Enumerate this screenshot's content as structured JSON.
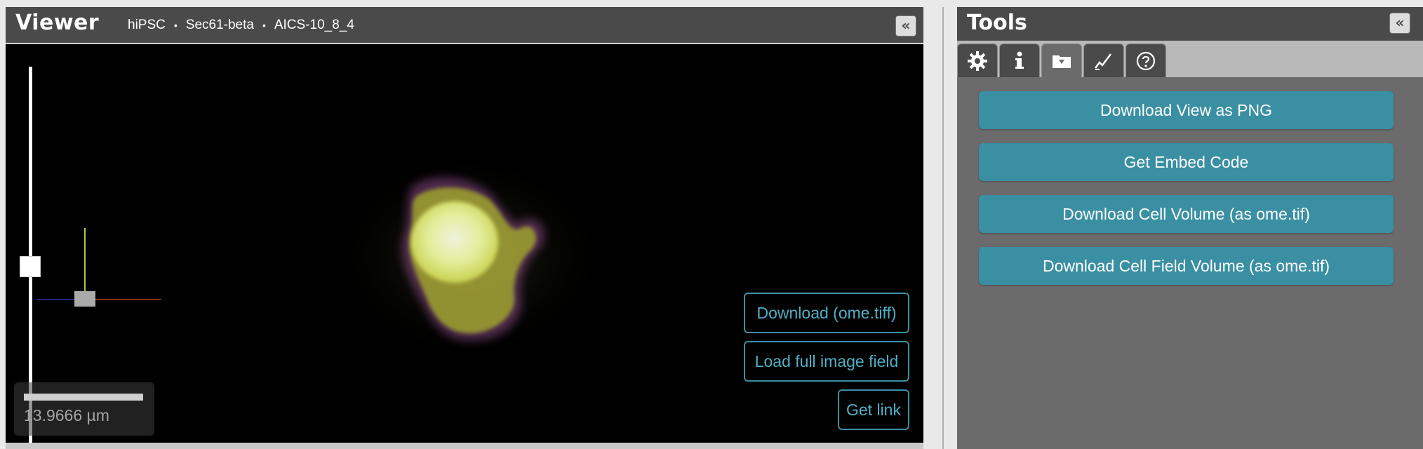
{
  "viewer": {
    "title": "Viewer",
    "breadcrumb": [
      "hiPSC",
      "Sec61-beta",
      "AICS-10_8_4"
    ],
    "breadcrumb_separator": "•",
    "collapse_glyph": "«",
    "scale_label": "13.9666 µm",
    "overlay_buttons": {
      "download_ome": "Download (ome.tiff)",
      "load_full": "Load full image field",
      "get_link": "Get link"
    }
  },
  "tools": {
    "title": "Tools",
    "collapse_glyph": "«",
    "tabs": [
      {
        "icon": "gear-icon",
        "active": false
      },
      {
        "icon": "info-icon",
        "active": false
      },
      {
        "icon": "download-folder-icon",
        "active": true
      },
      {
        "icon": "chart-line-icon",
        "active": false
      },
      {
        "icon": "help-icon",
        "active": false
      }
    ],
    "buttons": [
      "Download View as PNG",
      "Get Embed Code",
      "Download Cell Volume (as ome.tif)",
      "Download Cell Field Volume (as ome.tif)"
    ]
  },
  "colors": {
    "accent": "#3a8fa3",
    "header": "#4a4a4a",
    "panel": "#6b6b6b"
  }
}
